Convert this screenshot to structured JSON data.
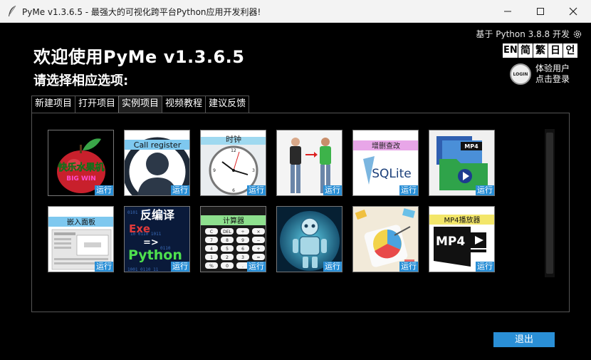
{
  "window": {
    "title": "PyMe v1.3.6.5 -  最强大的可视化跨平台Python应用开发利器!"
  },
  "header": {
    "version_info": "基于 Python 3.8.8 开发",
    "welcome": "欢迎使用PyMe v1.3.6.5",
    "subtitle": "请选择相应选项:",
    "languages": [
      "EN",
      "简",
      "繁",
      "日",
      "언"
    ],
    "user_line1": "体验用户",
    "user_line2": "点击登录",
    "avatar_text": "LOGIN"
  },
  "tabs": [
    "新建项目",
    "打开项目",
    "实例项目",
    "视频教程",
    "建议反馈"
  ],
  "active_tab": 2,
  "tiles": [
    {
      "caption": "快乐水果机",
      "run": "运行"
    },
    {
      "caption": "Call register",
      "run": "运行"
    },
    {
      "caption": "时钟",
      "run": "运行"
    },
    {
      "caption": "",
      "run": "运行"
    },
    {
      "caption": "增删查改",
      "caption2": "SQLite",
      "run": "运行"
    },
    {
      "caption": "MP4",
      "run": "运行"
    },
    {
      "caption": "嵌入面板",
      "run": "运行"
    },
    {
      "caption": "反编译",
      "caption2": "Exe",
      "caption3": "=>",
      "caption4": "Python",
      "run": "运行"
    },
    {
      "caption": "计算器",
      "run": "运行"
    },
    {
      "caption": "",
      "run": "运行"
    },
    {
      "caption": "",
      "run": "运行"
    },
    {
      "caption": "MP4播放器",
      "caption2": "MP4",
      "run": "运行"
    }
  ],
  "calc_keys": [
    "C",
    "DEL",
    "÷",
    "×",
    "7",
    "8",
    "9",
    "−",
    "4",
    "5",
    "6",
    "+",
    "1",
    "2",
    "3",
    "=",
    "%",
    "0",
    "."
  ],
  "footer": {
    "exit_label": "退出"
  },
  "colors": {
    "accent": "#2a8fd6",
    "background": "#000000"
  }
}
